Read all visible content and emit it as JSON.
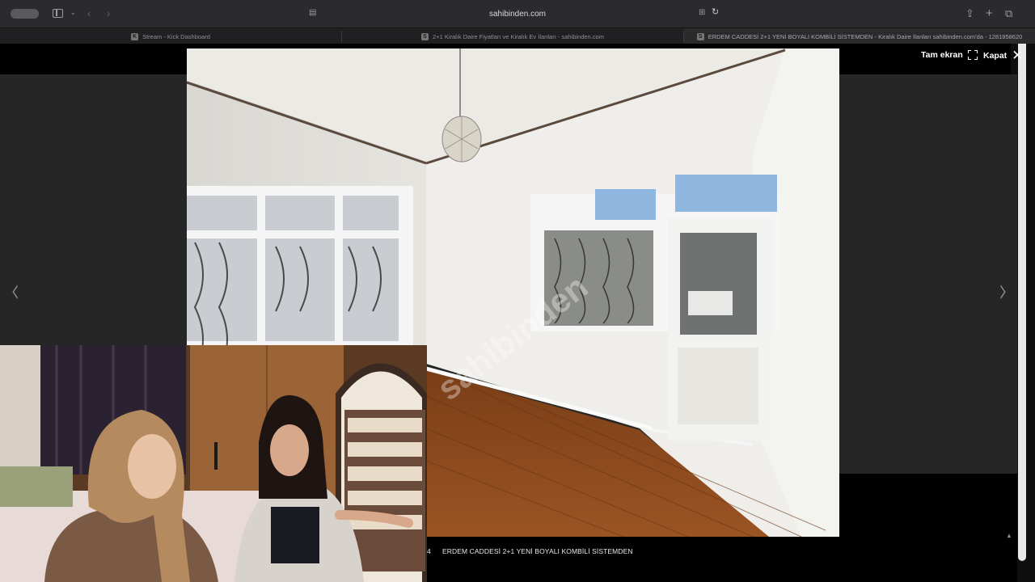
{
  "browser": {
    "url": "sahibinden.com",
    "tabs": [
      {
        "title": "Stream - Kick Dashboard",
        "favicon": "K",
        "active": false
      },
      {
        "title": "2+1 Kiralık Daire Fiyatları ve Kiralık Ev İlanları - sahibinden.com",
        "favicon": "S",
        "active": false
      },
      {
        "title": "ERDEM CADDESİ 2+1 YENİ BOYALI KOMBİLİ SİSTEMDEN - Kiralık Daire İlanları sahibinden.com'da - 1281958620",
        "favicon": "S",
        "active": true
      }
    ]
  },
  "lightbox": {
    "fullscreen_label": "Tam ekran",
    "close_label": "Kapat",
    "prev_arrow": "‹",
    "next_arrow": "›",
    "watermark": "sahibinden",
    "counter_fragment": "4",
    "caption": "ERDEM CADDESİ 2+1 YENİ BOYALI KOMBİLİ SİSTEMDEN"
  },
  "colors": {
    "page_bg": "#262626",
    "chrome_bg": "#2b2b2d",
    "floor": "#8a4a1e",
    "wall": "#e9e8e4"
  }
}
